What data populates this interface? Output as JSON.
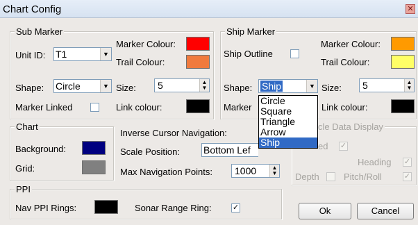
{
  "window": {
    "title": "Chart Config",
    "close_icon": "close-icon"
  },
  "sub_marker": {
    "legend": "Sub Marker",
    "unit_id_label": "Unit ID:",
    "unit_id_value": "T1",
    "marker_colour_label": "Marker Colour:",
    "marker_colour": "#ff0000",
    "trail_colour_label": "Trail Colour:",
    "trail_colour": "#f07a3d",
    "shape_label": "Shape:",
    "shape_value": "Circle",
    "size_label": "Size:",
    "size_value": "5",
    "marker_linked_label": "Marker Linked",
    "marker_linked_checked": false,
    "link_colour_label": "Link colour:",
    "link_colour": "#000000"
  },
  "ship_marker": {
    "legend": "Ship Marker",
    "ship_outline_label": "Ship Outline",
    "ship_outline_checked": false,
    "marker_colour_label": "Marker Colour:",
    "marker_colour": "#ff9a00",
    "trail_colour_label": "Trail Colour:",
    "trail_colour": "#ffff66",
    "shape_label": "Shape:",
    "shape_value": "Ship",
    "size_label": "Size:",
    "size_value": "5",
    "marker_label_partial": "Marker",
    "link_colour_label": "Link colour:",
    "link_colour": "#000000",
    "shape_options": [
      "Circle",
      "Square",
      "Triangle",
      "Arrow",
      "Ship"
    ],
    "shape_selected": "Ship"
  },
  "chart": {
    "legend": "Chart",
    "background_label": "Background:",
    "background_colour": "#000080",
    "grid_label": "Grid:",
    "grid_colour": "#808080"
  },
  "navigation": {
    "inverse_cursor_label": "Inverse Cursor Navigation:",
    "scale_position_label": "Scale Position:",
    "scale_position_value": "Bottom Lef",
    "max_points_label": "Max Navigation Points:",
    "max_points_value": "1000"
  },
  "vehicle_data": {
    "legend_partial": "cle Data Display",
    "speed_partial": "ed",
    "speed_checked": true,
    "heading_label": "Heading",
    "heading_checked": true,
    "depth_label": "Depth",
    "depth_checked": false,
    "pitch_roll_label": "Pitch/Roll",
    "pitch_roll_checked": true
  },
  "ppi": {
    "legend": "PPI",
    "nav_rings_label": "Nav PPI Rings:",
    "nav_rings_colour": "#000000",
    "sonar_range_label": "Sonar Range Ring:",
    "sonar_range_checked": true
  },
  "buttons": {
    "ok": "Ok",
    "cancel": "Cancel"
  }
}
